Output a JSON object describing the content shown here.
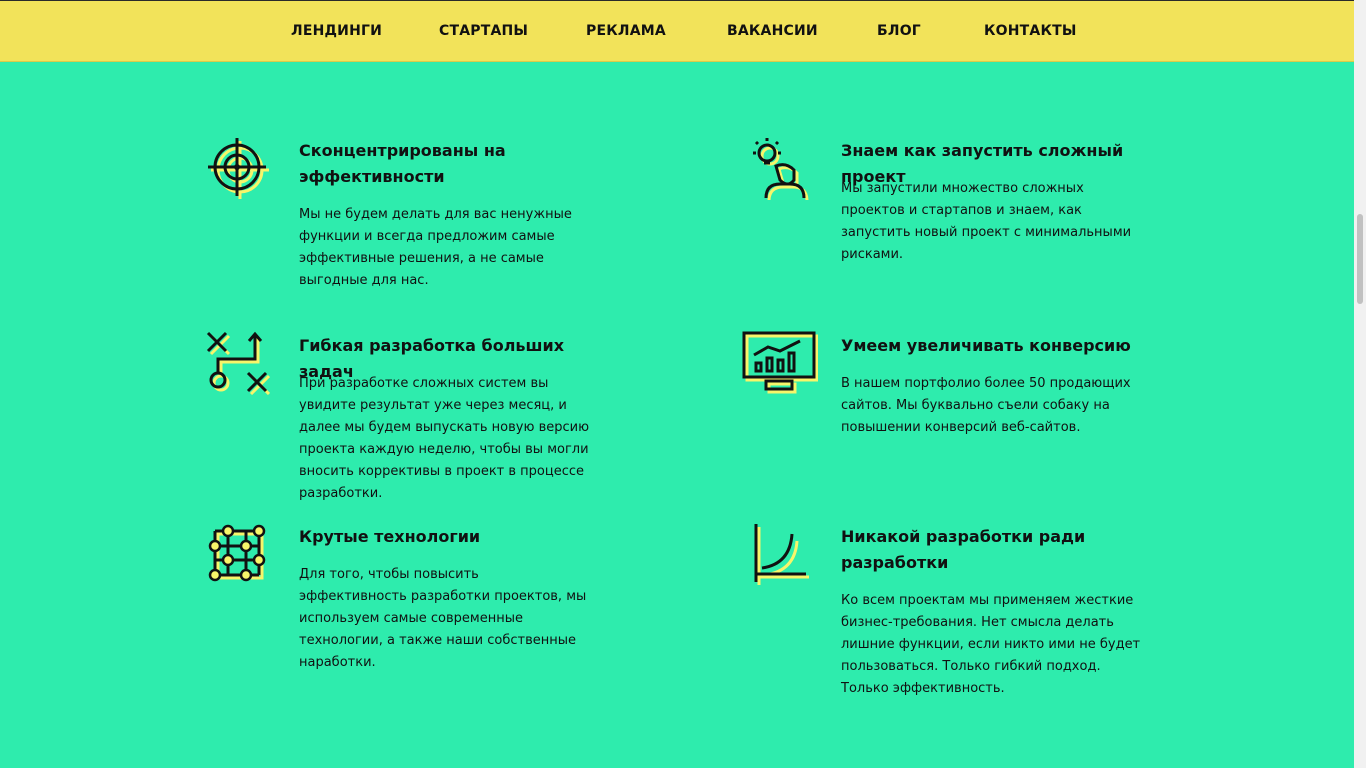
{
  "nav": {
    "items": [
      "ЛЕНДИНГИ",
      "СТАРТАПЫ",
      "РЕКЛАМА",
      "ВАКАНСИИ",
      "БЛОГ",
      "КОНТАКТЫ"
    ]
  },
  "colors": {
    "background": "#2eecad",
    "nav_background": "#f2e35a",
    "icon_shadow": "#f7f56a",
    "text": "#111111"
  },
  "features": [
    {
      "icon": "target-icon",
      "title": "Сконцентрированы на эффективности",
      "text": "Мы не будем делать для вас ненужные функции и всегда предложим самые эффективные решения, а не самые выгодные для нас."
    },
    {
      "icon": "idea-person-icon",
      "title": "Знаем как запустить сложный проект",
      "text": "Мы запустили множество сложных проектов и стартапов и знаем, как запустить новый проект с минимальными рисками."
    },
    {
      "icon": "strategy-icon",
      "title": "Гибкая разработка больших задач",
      "text": "При разработке сложных систем вы увидите результат уже через месяц, и далее мы будем выпускать новую версию проекта каждую неделю, чтобы вы могли вносить коррективы в проект в процессе разработки."
    },
    {
      "icon": "monitor-chart-icon",
      "title": "Умеем увеличивать конверсию",
      "text": "В нашем портфолио более 50 продающих сайтов. Мы буквально съели собаку на повышении конверсий веб-сайтов."
    },
    {
      "icon": "network-grid-icon",
      "title": "Крутые технологии",
      "text": "Для того, чтобы повысить эффективность разработки проектов, мы используем самые современные технологии, а также наши собственные наработки."
    },
    {
      "icon": "growth-curve-icon",
      "title": "Никакой разработки ради разработки",
      "text": "Ко всем проектам мы применяем жесткие бизнес-требования. Нет смысла делать лишние функции, если никто ими не будет пользоваться. Только гибкий подход. Только эффективность."
    }
  ]
}
